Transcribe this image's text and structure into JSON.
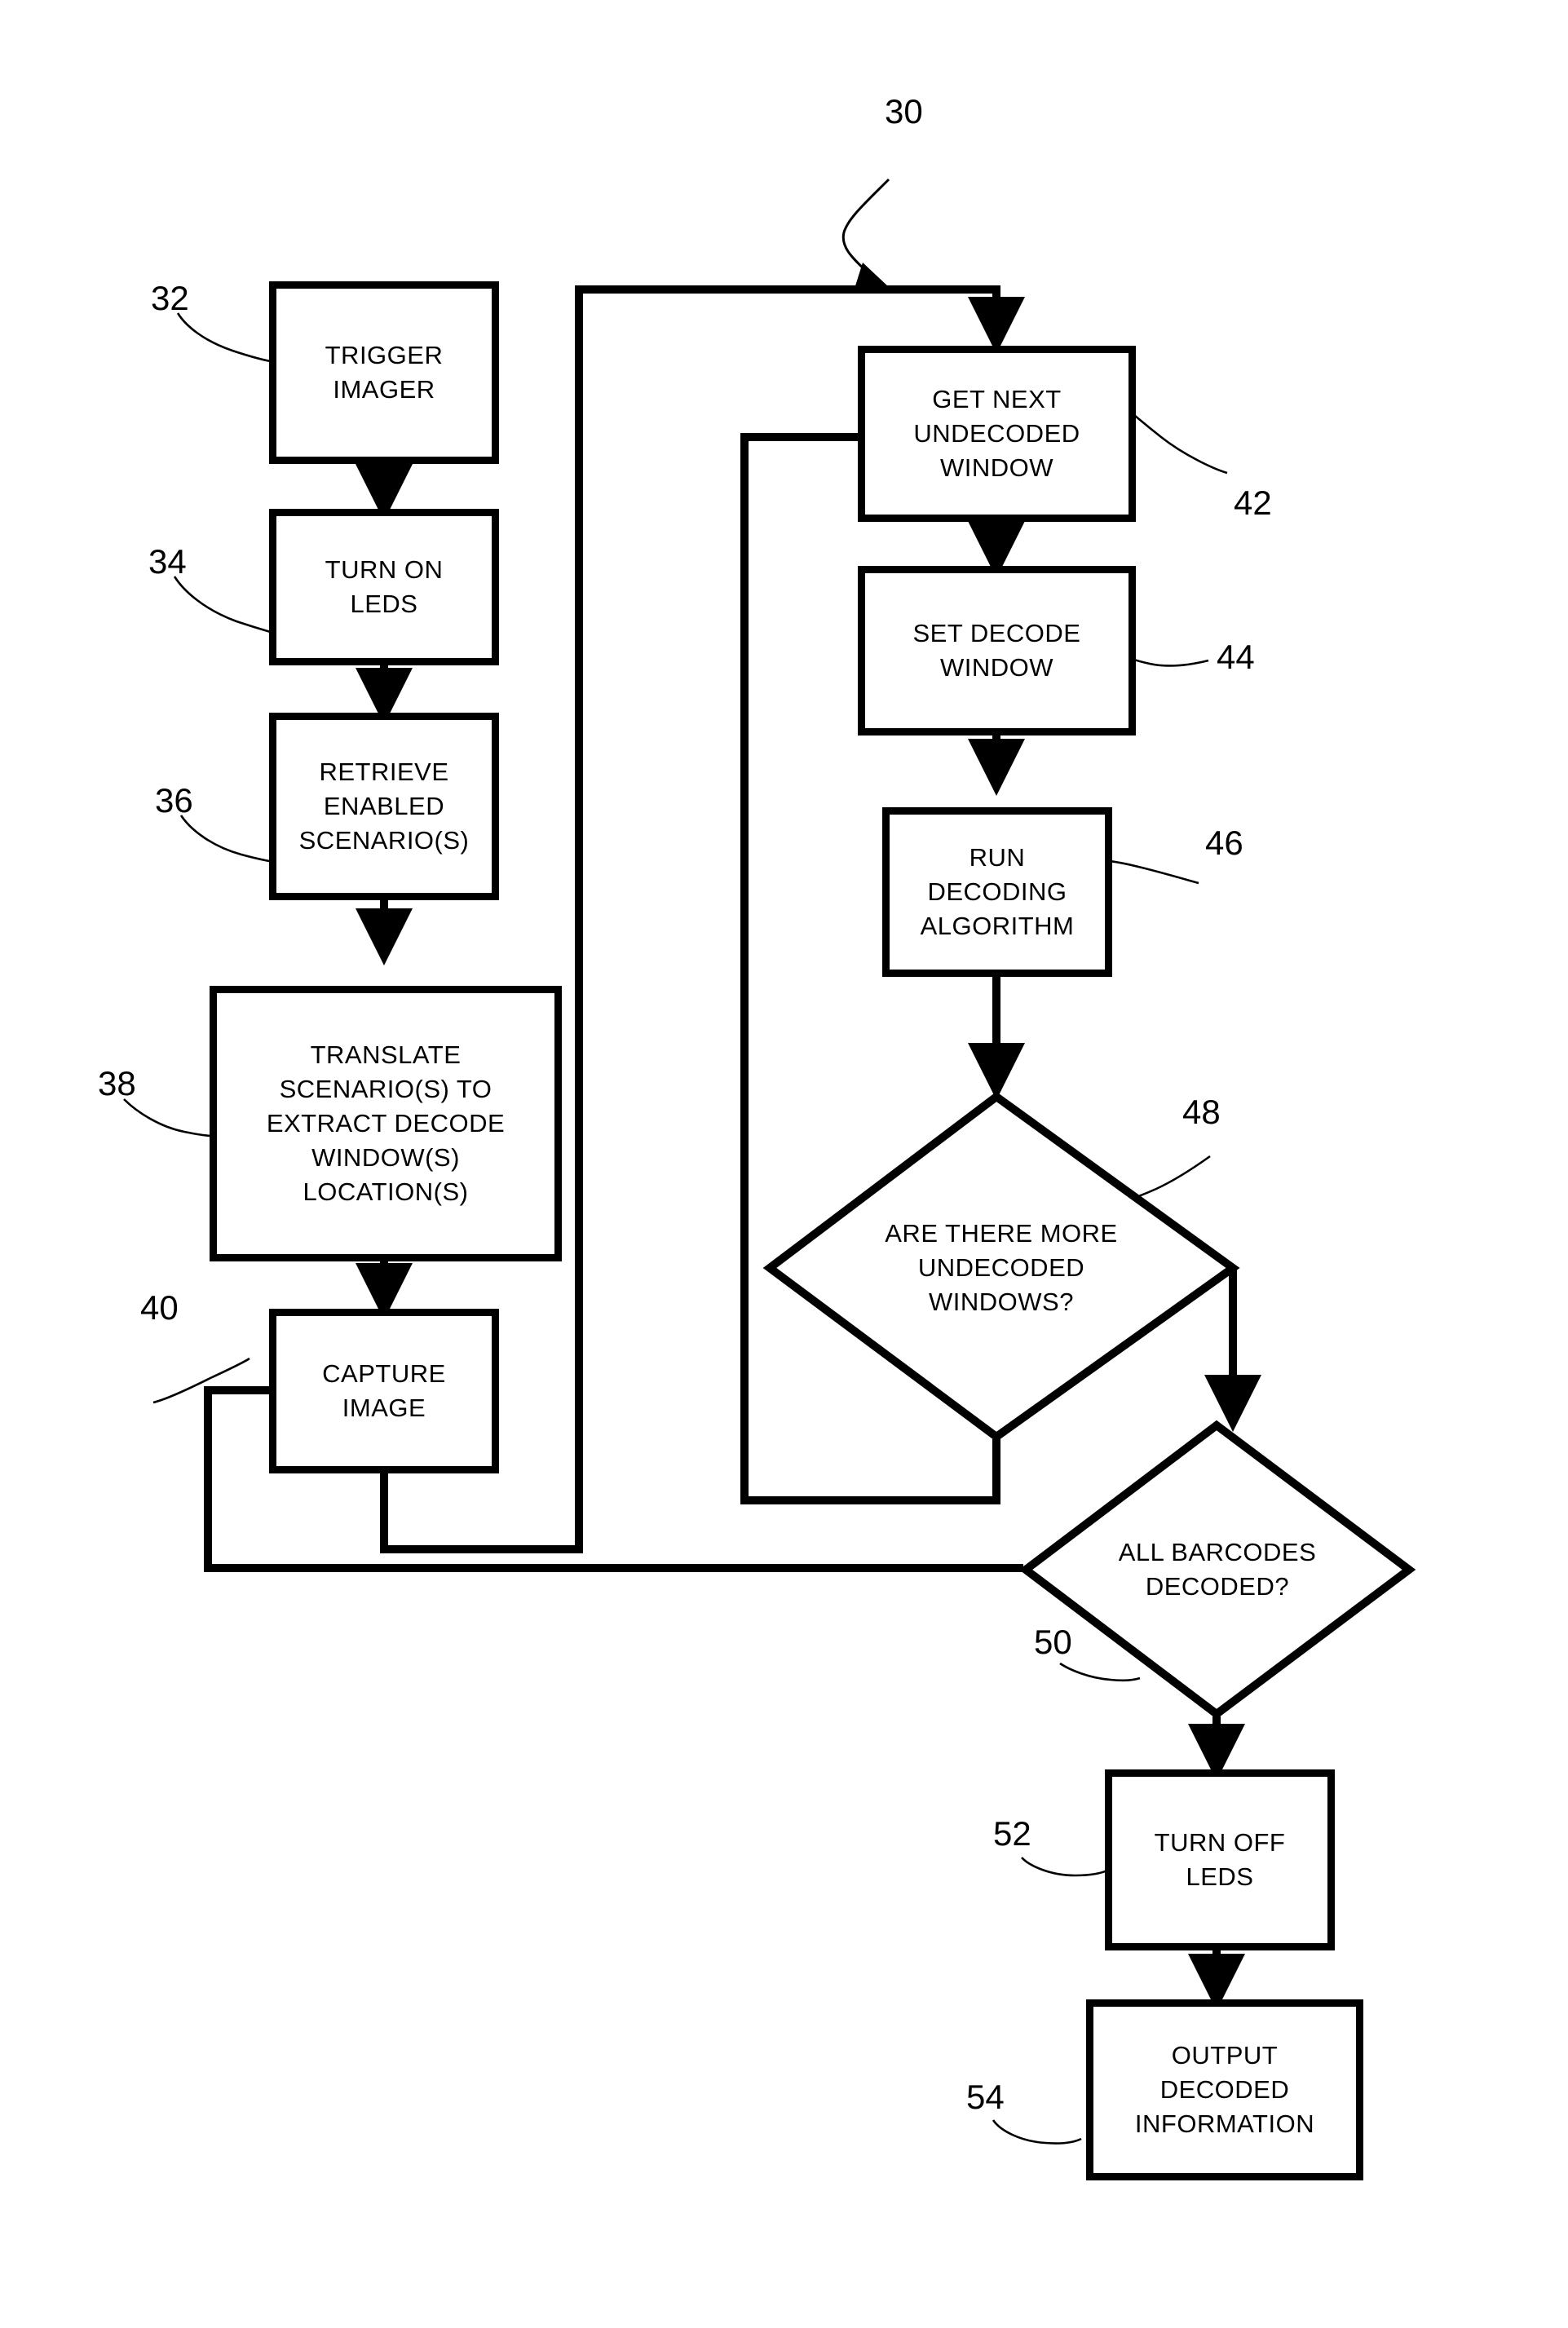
{
  "figure": {
    "title_numeral": "30"
  },
  "nodes": [
    {
      "id": "trigger_imager",
      "ref": "32",
      "text": "TRIGGER\nIMAGER",
      "shape": "process"
    },
    {
      "id": "turn_on_leds",
      "ref": "34",
      "text": "TURN ON\nLEDS",
      "shape": "process"
    },
    {
      "id": "retrieve_scenarios",
      "ref": "36",
      "text": "RETRIEVE\nENABLED\nSCENARIO(S)",
      "shape": "process"
    },
    {
      "id": "translate_scenarios",
      "ref": "38",
      "text": "TRANSLATE\nSCENARIO(S) TO\nEXTRACT DECODE\nWINDOW(S)\nLOCATION(S)",
      "shape": "process"
    },
    {
      "id": "capture_image",
      "ref": "40",
      "text": "CAPTURE\nIMAGE",
      "shape": "process"
    },
    {
      "id": "get_next_window",
      "ref": "42",
      "text": "GET NEXT\nUNDECODED\nWINDOW",
      "shape": "process"
    },
    {
      "id": "set_decode_window",
      "ref": "44",
      "text": "SET DECODE\nWINDOW",
      "shape": "process"
    },
    {
      "id": "run_decoding",
      "ref": "46",
      "text": "RUN\nDECODING\nALGORITHM",
      "shape": "process"
    },
    {
      "id": "more_windows",
      "ref": "48",
      "text": "ARE THERE MORE\nUNDECODED\nWINDOWS?",
      "shape": "decision"
    },
    {
      "id": "all_decoded",
      "ref": "50",
      "text": "ALL BARCODES\nDECODED?",
      "shape": "decision"
    },
    {
      "id": "turn_off_leds",
      "ref": "52",
      "text": "TURN OFF\nLEDS",
      "shape": "process"
    },
    {
      "id": "output_decoded",
      "ref": "54",
      "text": "OUTPUT\nDECODED\nINFORMATION",
      "shape": "process"
    }
  ],
  "colors": {
    "stroke": "#000000",
    "fill": "#ffffff",
    "text": "#000000"
  }
}
